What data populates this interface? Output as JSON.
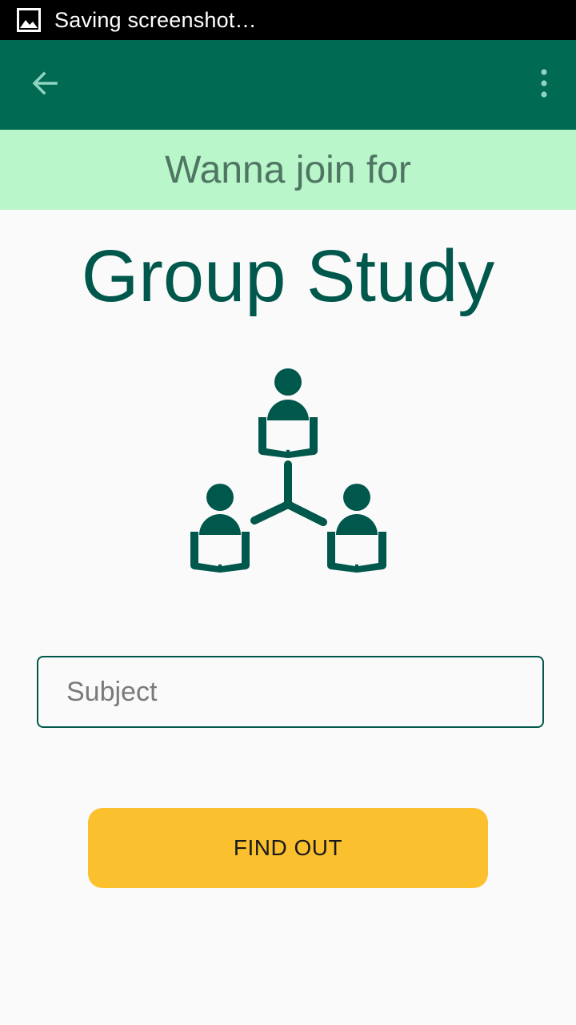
{
  "status_bar": {
    "notification_icon": "image-icon",
    "text": "Saving screenshot…"
  },
  "app_bar": {
    "back_icon": "arrow-back-icon",
    "overflow_icon": "more-vert-icon"
  },
  "banner": {
    "text": "Wanna join for"
  },
  "main": {
    "title": "Group Study",
    "illustration_icon": "group-study-icon",
    "subject_placeholder": "Subject",
    "subject_value": "",
    "find_button_label": "FIND OUT"
  },
  "colors": {
    "status_bar": "#000000",
    "app_bar": "#006a52",
    "banner_bg": "#b9f6ca",
    "banner_text": "#4f7563",
    "title": "#00574b",
    "button": "#fbc02d"
  }
}
